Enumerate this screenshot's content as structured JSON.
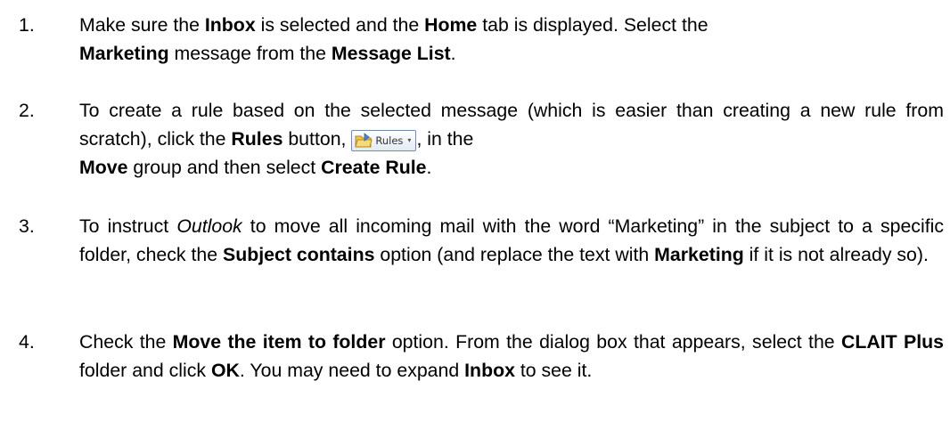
{
  "steps": [
    {
      "number": "1.",
      "parts": [
        "Make sure the ",
        "Inbox",
        " is selected and the ",
        "Home",
        " tab is displayed. Select the ",
        "Marketing",
        " message from the ",
        "Message List",
        "."
      ]
    },
    {
      "number": "2.",
      "parts": [
        "To create a rule based on the selected message (which is easier than creating a new rule from scratch), click the ",
        "Rules",
        " button, ",
        ", in the ",
        "Move",
        " group and then select ",
        "Create Rule",
        "."
      ],
      "button": {
        "label": "Rules",
        "icon": "rules-folder-icon",
        "caret": "▾"
      }
    },
    {
      "number": "3.",
      "parts": [
        "To instruct ",
        "Outlook",
        " to move all incoming mail with the word “Marketing” in the subject to a specific folder, check the ",
        "Subject contains",
        " option (and replace the text with ",
        "Marketing",
        " if it is not already so)."
      ]
    },
    {
      "number": "4.",
      "parts": [
        "Check the ",
        "Move the item to folder",
        " option. From the dialog box that appears, select the ",
        "CLAIT Plus",
        " folder and click ",
        "OK",
        ". You may need to expand ",
        "Inbox",
        " to see it."
      ]
    }
  ]
}
